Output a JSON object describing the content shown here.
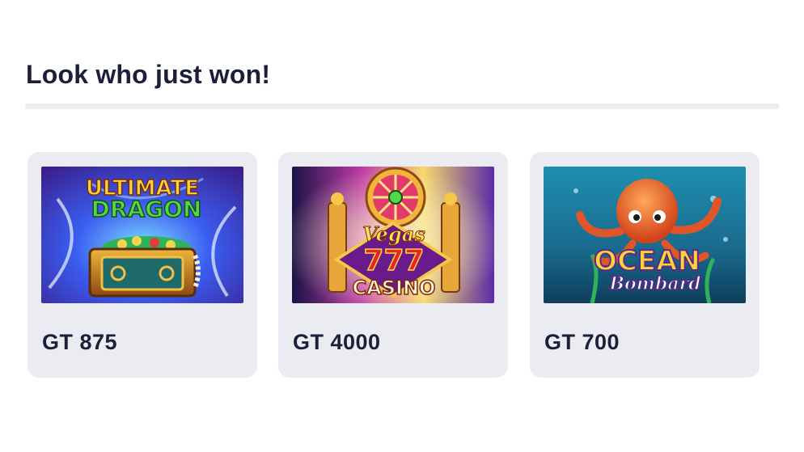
{
  "section": {
    "title": "Look who just won!"
  },
  "winners": [
    {
      "game": "Ultimate Dragon",
      "amount": "GT 875",
      "art_lines": [
        "ULTIMATE",
        "DRAGON"
      ]
    },
    {
      "game": "Vegas 777 Casino",
      "amount": "GT 4000",
      "art_lines": [
        "Vegas",
        "777",
        "CASINO"
      ]
    },
    {
      "game": "Ocean Bombard",
      "amount": "GT 700",
      "art_lines": [
        "OCEAN",
        "Bombard"
      ]
    }
  ],
  "colors": {
    "title": "#1b1f3a",
    "card_bg": "#ebebf2",
    "divider": "#ececf1"
  }
}
